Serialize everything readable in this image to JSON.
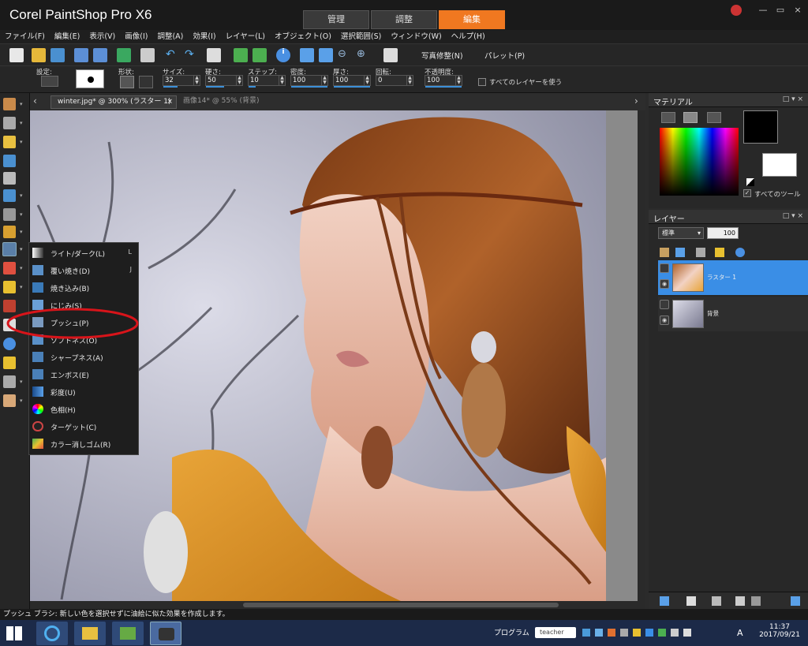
{
  "window": {
    "title": "Corel PaintShop Pro X6",
    "tabs": [
      {
        "label": "管理"
      },
      {
        "label": "調整"
      },
      {
        "label": "編集"
      }
    ],
    "controls": [
      "—",
      "▭",
      "×"
    ]
  },
  "menu": [
    "ファイル(F)",
    "編集(E)",
    "表示(V)",
    "画像(I)",
    "調整(A)",
    "効果(I)",
    "レイヤー(L)",
    "オブジェクト(O)",
    "選択範囲(S)",
    "ウィンドウ(W)",
    "ヘルプ(H)"
  ],
  "toolbar": {
    "photo_fix": "写真修整(N)",
    "palette": "パレット(P)"
  },
  "options": {
    "preset_label": "設定:",
    "shape_label": "形状:",
    "size": {
      "label": "サイズ:",
      "value": "32"
    },
    "hardness": {
      "label": "硬さ:",
      "value": "50"
    },
    "step": {
      "label": "ステップ:",
      "value": "10"
    },
    "density": {
      "label": "密度:",
      "value": "100"
    },
    "thickness": {
      "label": "厚さ:",
      "value": "100"
    },
    "rotation": {
      "label": "回転:",
      "value": "0"
    },
    "opacity": {
      "label": "不透明度:",
      "value": "100"
    },
    "all_layers": "すべてのレイヤーを使う"
  },
  "document_tabs": [
    {
      "label": "winter.jpg* @ 300% (ラスター 1)",
      "close": "×"
    },
    {
      "label": "画像14* @ 55% (背景)"
    }
  ],
  "flyout": {
    "items": [
      {
        "label": "ライト/ダーク(L)",
        "shortcut": "L"
      },
      {
        "label": "覆い焼き(D)",
        "shortcut": "J"
      },
      {
        "label": "焼き込み(B)",
        "shortcut": ""
      },
      {
        "label": "にじみ(S)",
        "shortcut": ""
      },
      {
        "label": "プッシュ(P)",
        "shortcut": ""
      },
      {
        "label": "ソフトネス(O)",
        "shortcut": ""
      },
      {
        "label": "シャープネス(A)",
        "shortcut": ""
      },
      {
        "label": "エンボス(E)",
        "shortcut": ""
      },
      {
        "label": "彩度(U)",
        "shortcut": ""
      },
      {
        "label": "色相(H)",
        "shortcut": ""
      },
      {
        "label": "ターゲット(C)",
        "shortcut": ""
      },
      {
        "label": "カラー消しゴム(R)",
        "shortcut": ""
      }
    ]
  },
  "materials": {
    "title": "マテリアル",
    "all_tools": "すべてのツール"
  },
  "layers": {
    "title": "レイヤー",
    "blend_mode": "標準",
    "opacity": "100",
    "items": [
      {
        "name": "ラスター 1",
        "selected": true
      },
      {
        "name": "背景",
        "selected": false
      }
    ]
  },
  "status": "プッシュ ブラシ: 新しい色を選択せずに油絵に似た効果を作成します。",
  "taskbar": {
    "program_label": "プログラム",
    "search_value": "teacher",
    "time": "11:37",
    "date": "2017/09/21",
    "ime": "A"
  },
  "colors": {
    "accent": "#f07820",
    "selection": "#3a8ee6",
    "highlight_ring": "#d8141a"
  }
}
